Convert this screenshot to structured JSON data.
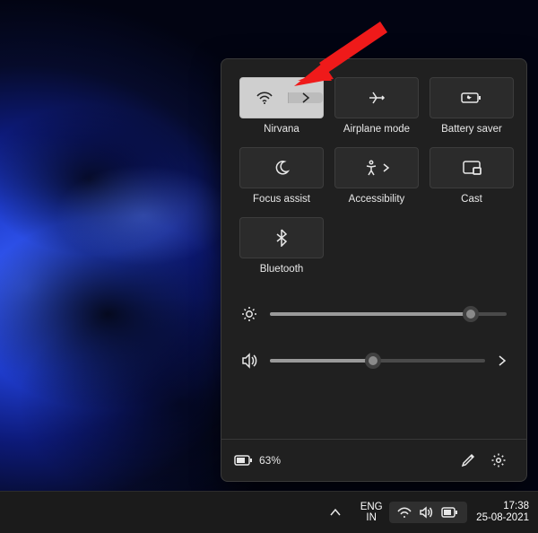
{
  "tiles": {
    "wifi": {
      "label": "Nirvana"
    },
    "airplane": {
      "label": "Airplane mode"
    },
    "battery": {
      "label": "Battery saver"
    },
    "focus": {
      "label": "Focus assist"
    },
    "access": {
      "label": "Accessibility"
    },
    "cast": {
      "label": "Cast"
    },
    "bluetooth": {
      "label": "Bluetooth"
    }
  },
  "sliders": {
    "brightness": 85,
    "volume": 48
  },
  "footer": {
    "battery_text": "63%"
  },
  "taskbar": {
    "lang_top": "ENG",
    "lang_bottom": "IN",
    "time": "17:38",
    "date": "25-08-2021"
  }
}
